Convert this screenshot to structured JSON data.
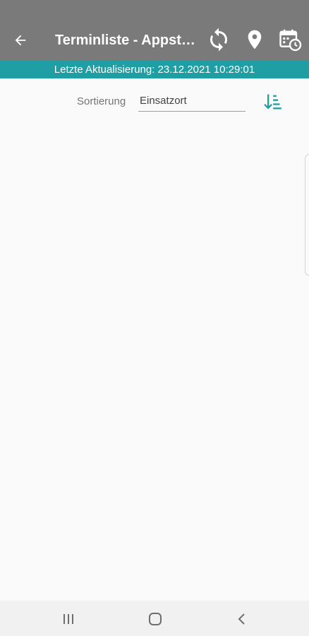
{
  "appbar": {
    "title": "Terminliste - Appstore Testsys",
    "background": "#7a7a7a",
    "icons": [
      "back-arrow-icon",
      "sync-icon",
      "location-pin-icon",
      "calendar-clock-icon"
    ]
  },
  "status": {
    "text": "Letzte Aktualisierung: 23.12.2021 10:29:01",
    "background": "#1f9ea3"
  },
  "sort": {
    "label": "Sortierung",
    "value": "Einsatzort",
    "order_icon": "sort-ascending-icon",
    "accent": "#1f9ea3"
  },
  "navbar": {
    "icons": [
      "recent-apps-icon",
      "home-icon",
      "back-icon"
    ]
  }
}
